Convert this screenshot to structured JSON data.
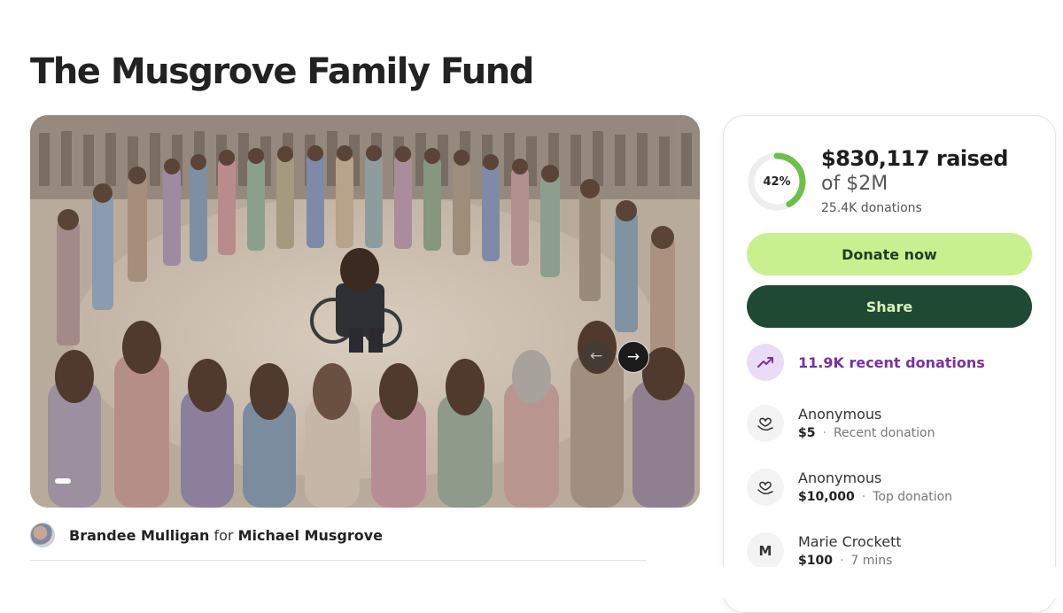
{
  "page": {
    "title": "The Musgrove Family Fund"
  },
  "hero": {
    "prev_icon": "arrow-left-icon",
    "next_icon": "arrow-right-icon"
  },
  "organizer": {
    "name": "Brandee Mulligan",
    "connector": "for",
    "beneficiary": "Michael Musgrove"
  },
  "donation_card": {
    "progress_percent": 42,
    "progress_label": "42%",
    "raised": "$830,117 raised",
    "goal": "of $2M",
    "donation_count": "25.4K donations",
    "donate_label": "Donate now",
    "share_label": "Share",
    "recent_label": "11.9K recent donations",
    "colors": {
      "accent_green": "#c8f08f",
      "dark_green": "#1e4a33",
      "progress_green": "#6cc04a",
      "purple": "#7b2fa6"
    },
    "donors": [
      {
        "icon": "heart-hand-icon",
        "name": "Anonymous",
        "amount": "$5",
        "note": "Recent donation"
      },
      {
        "icon": "heart-hand-icon",
        "name": "Anonymous",
        "amount": "$10,000",
        "note": "Top donation"
      },
      {
        "icon": "initial-avatar",
        "initial": "M",
        "name": "Marie Crockett",
        "amount": "$100",
        "note": "7 mins"
      }
    ]
  }
}
